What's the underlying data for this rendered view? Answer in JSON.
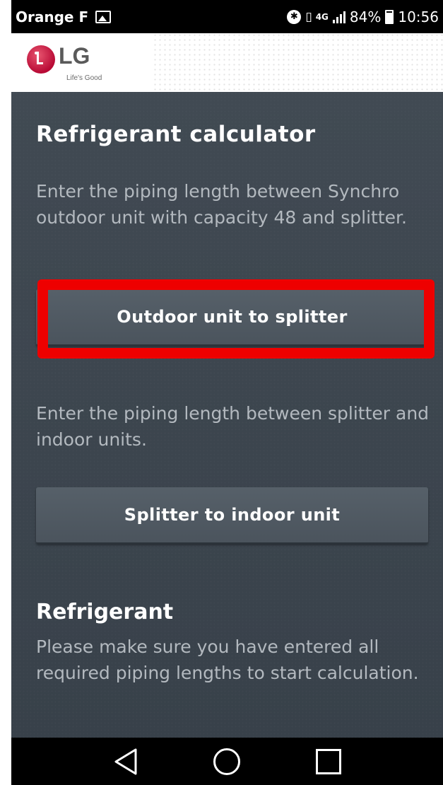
{
  "status_bar": {
    "carrier": "Orange F",
    "network": "4G",
    "battery_percent": "84%",
    "time": "10:56",
    "icons": [
      "gallery-icon",
      "bluetooth-icon",
      "vibrate-icon",
      "network-4g-icon",
      "signal-icon",
      "battery-icon"
    ]
  },
  "header": {
    "brand": "LG",
    "tagline": "Life's Good",
    "logo_color": "#b80a35"
  },
  "calculator": {
    "title": "Refrigerant calculator",
    "description_1": "Enter the piping length between Synchro outdoor unit with capacity 48 and splitter.",
    "outdoor_button_label": "Outdoor unit to splitter",
    "description_2": "Enter the piping length between splitter and indoor units.",
    "splitter_button_label": "Splitter to indoor unit"
  },
  "refrigerant": {
    "title": "Refrigerant",
    "message": "Please make sure you have entered all required piping lengths to start calculation."
  },
  "navigation": {
    "buttons": [
      "back-icon",
      "home-icon",
      "recent-apps-icon"
    ]
  },
  "colors": {
    "content_bg": "#3d454e",
    "button_bg": "#525b64",
    "highlight": "#ee0000",
    "text_muted": "#b3b9bf"
  }
}
